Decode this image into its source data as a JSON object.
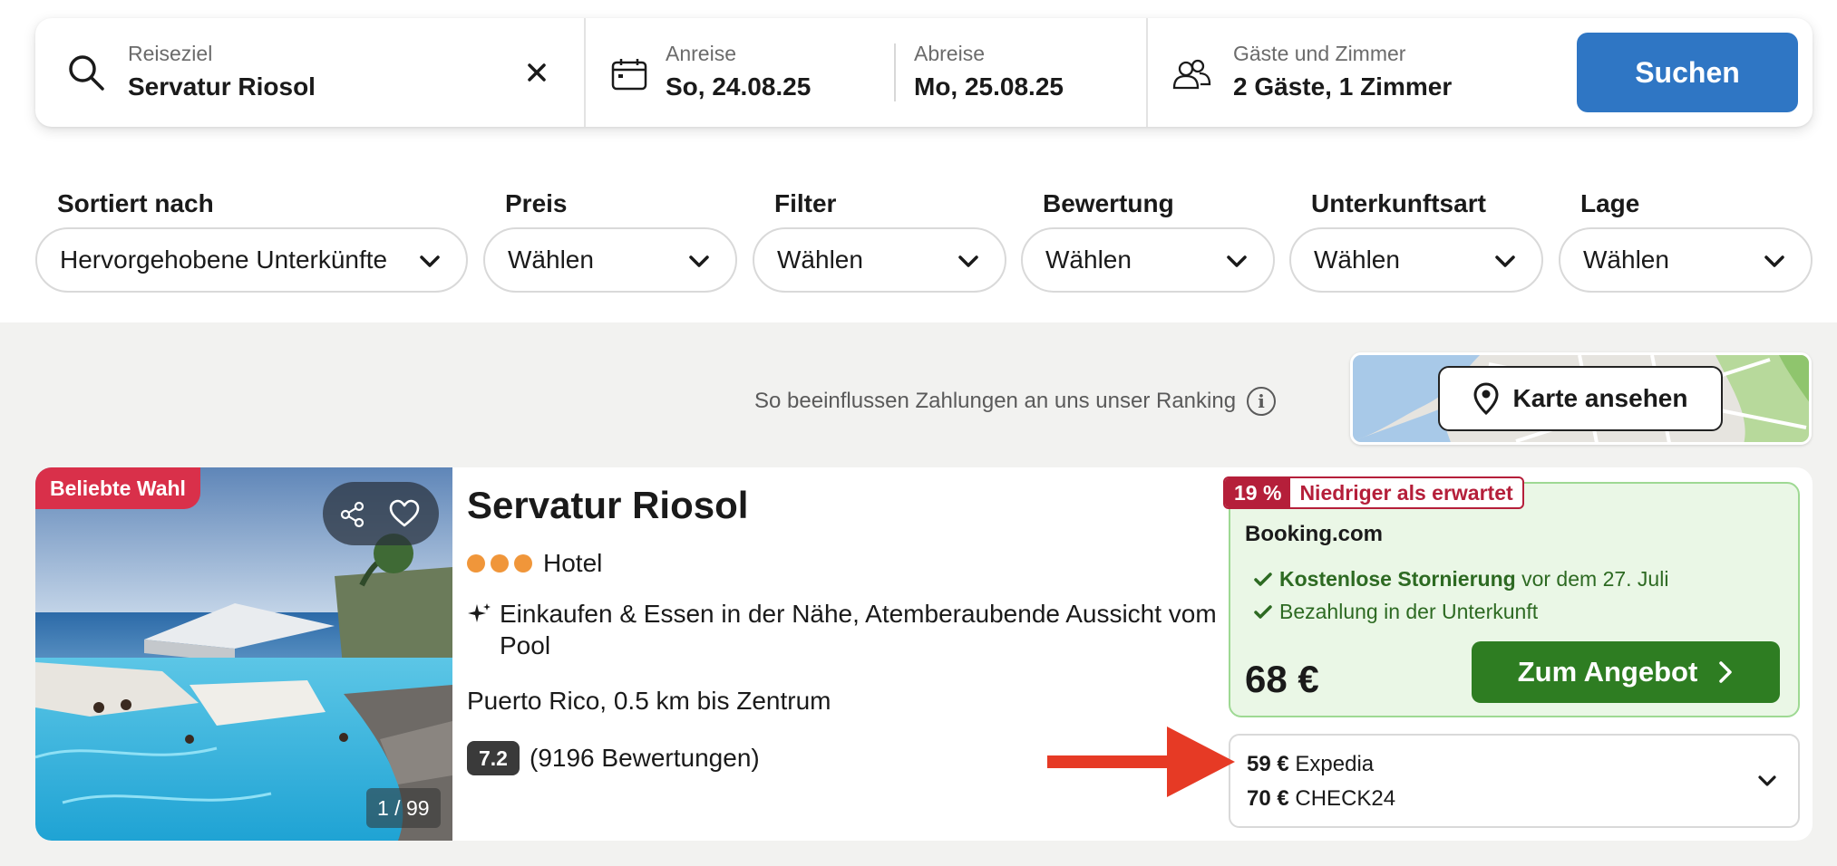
{
  "search": {
    "destination_label": "Reiseziel",
    "destination_value": "Servatur Riosol",
    "checkin_label": "Anreise",
    "checkin_value": "So, 24.08.25",
    "checkout_label": "Abreise",
    "checkout_value": "Mo, 25.08.25",
    "guests_label": "Gäste und Zimmer",
    "guests_value": "2 Gäste, 1 Zimmer",
    "search_button": "Suchen"
  },
  "filters": [
    {
      "label": "Sortiert nach",
      "value": "Hervorgehobene Unterkünfte"
    },
    {
      "label": "Preis",
      "value": "Wählen"
    },
    {
      "label": "Filter",
      "value": "Wählen"
    },
    {
      "label": "Bewertung",
      "value": "Wählen"
    },
    {
      "label": "Unterkunftsart",
      "value": "Wählen"
    },
    {
      "label": "Lage",
      "value": "Wählen"
    }
  ],
  "ranking_note": "So beeinflussen Zahlungen an uns unser Ranking",
  "map_button": "Karte ansehen",
  "hotel": {
    "badge": "Beliebte Wahl",
    "photo_counter": "1 / 99",
    "name": "Servatur Riosol",
    "stars": 3,
    "type": "Hotel",
    "highlights": "Einkaufen & Essen in der Nähe, Atemberaubende Aussicht vom Pool",
    "location": "Puerto Rico, 0.5 km bis Zentrum",
    "rating": "7.2",
    "rating_count": "(9196 Bewertungen)"
  },
  "offer": {
    "deal_percent": "19 %",
    "deal_text": "Niedriger als erwartet",
    "provider": "Booking.com",
    "perk1_bold": "Kostenlose Stornierung",
    "perk1_rest": "vor dem 27. Juli",
    "perk2": "Bezahlung in der Unterkunft",
    "price": "68 €",
    "button": "Zum Angebot"
  },
  "other_offers": [
    {
      "price": "59 €",
      "provider": "Expedia"
    },
    {
      "price": "70 €",
      "provider": "CHECK24"
    }
  ],
  "colors": {
    "search_button": "#2f76c4",
    "offer_button": "#2e7d22",
    "badge": "#d9304a",
    "deal": "#b51f3a",
    "annotation_arrow": "#e63a25"
  }
}
